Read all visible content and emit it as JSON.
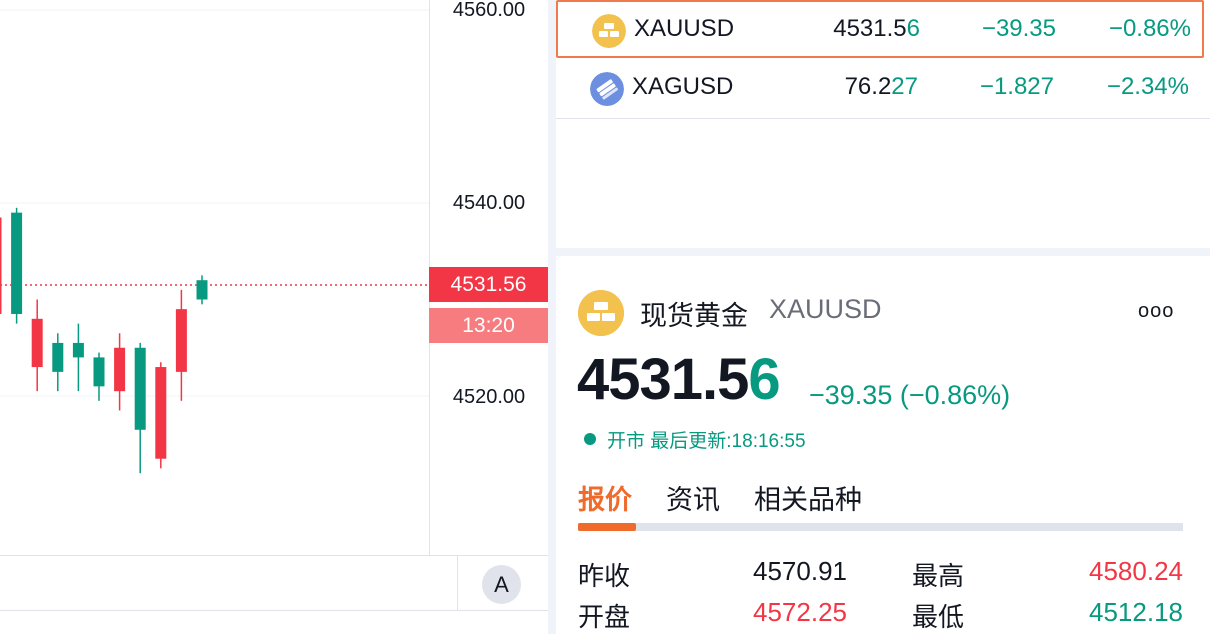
{
  "chart": {
    "axis_labels": [
      "4560.00",
      "4540.00",
      "4520.00"
    ],
    "current_price_tag": "4531.56",
    "countdown_tag": "13:20",
    "auto_scale_label": "A",
    "up_color": "#089981",
    "down_color": "#f23645",
    "candles": [
      {
        "o": 4538.5,
        "h": 4540.0,
        "l": 4523.0,
        "c": 4528.5
      },
      {
        "o": 4528.5,
        "h": 4539.5,
        "l": 4527.5,
        "c": 4539.0
      },
      {
        "o": 4528.0,
        "h": 4530.0,
        "l": 4520.5,
        "c": 4523.0
      },
      {
        "o": 4522.5,
        "h": 4526.5,
        "l": 4520.5,
        "c": 4525.5
      },
      {
        "o": 4524.0,
        "h": 4527.5,
        "l": 4520.5,
        "c": 4525.5
      },
      {
        "o": 4521.0,
        "h": 4524.5,
        "l": 4519.5,
        "c": 4524.0
      },
      {
        "o": 4525.0,
        "h": 4526.5,
        "l": 4518.5,
        "c": 4520.5
      },
      {
        "o": 4516.5,
        "h": 4525.5,
        "l": 4512.0,
        "c": 4525.0
      },
      {
        "o": 4523.0,
        "h": 4523.5,
        "l": 4512.5,
        "c": 4513.5
      },
      {
        "o": 4529.0,
        "h": 4531.0,
        "l": 4519.5,
        "c": 4522.5
      },
      {
        "o": 4530.0,
        "h": 4532.5,
        "l": 4529.5,
        "c": 4532.0
      }
    ]
  },
  "watchlist": [
    {
      "symbol": "XAUUSD",
      "last_main": "4531.5",
      "last_tail": "6",
      "change": "−39.35",
      "change_pct": "−0.86%",
      "selected": true,
      "icon": "gold-bars-icon"
    },
    {
      "symbol": "XAGUSD",
      "last_main": "76.2",
      "last_tail": "27",
      "change": "−1.827",
      "change_pct": "−2.34%",
      "selected": false,
      "icon": "silver-bars-icon"
    }
  ],
  "details": {
    "name": "现货黄金",
    "symbol": "XAUUSD",
    "more": "ooo",
    "price_main": "4531.5",
    "price_tail": "6",
    "change": "−39.35 (−0.86%)",
    "market_status": "开市 最后更新:18:16:55",
    "tabs": [
      "报价",
      "资讯",
      "相关品种"
    ],
    "stats": [
      {
        "label": "昨收",
        "value": "4570.91",
        "tone": "neutral"
      },
      {
        "label": "最高",
        "value": "4580.24",
        "tone": "up"
      },
      {
        "label": "开盘",
        "value": "4572.25",
        "tone": "up"
      },
      {
        "label": "最低",
        "value": "4512.18",
        "tone": "down"
      }
    ]
  },
  "colors": {
    "positive": "#089981",
    "negative": "#f23645",
    "accent": "#f06a2c",
    "gold": "#f2c14e",
    "silver": "#6c8fe0"
  }
}
